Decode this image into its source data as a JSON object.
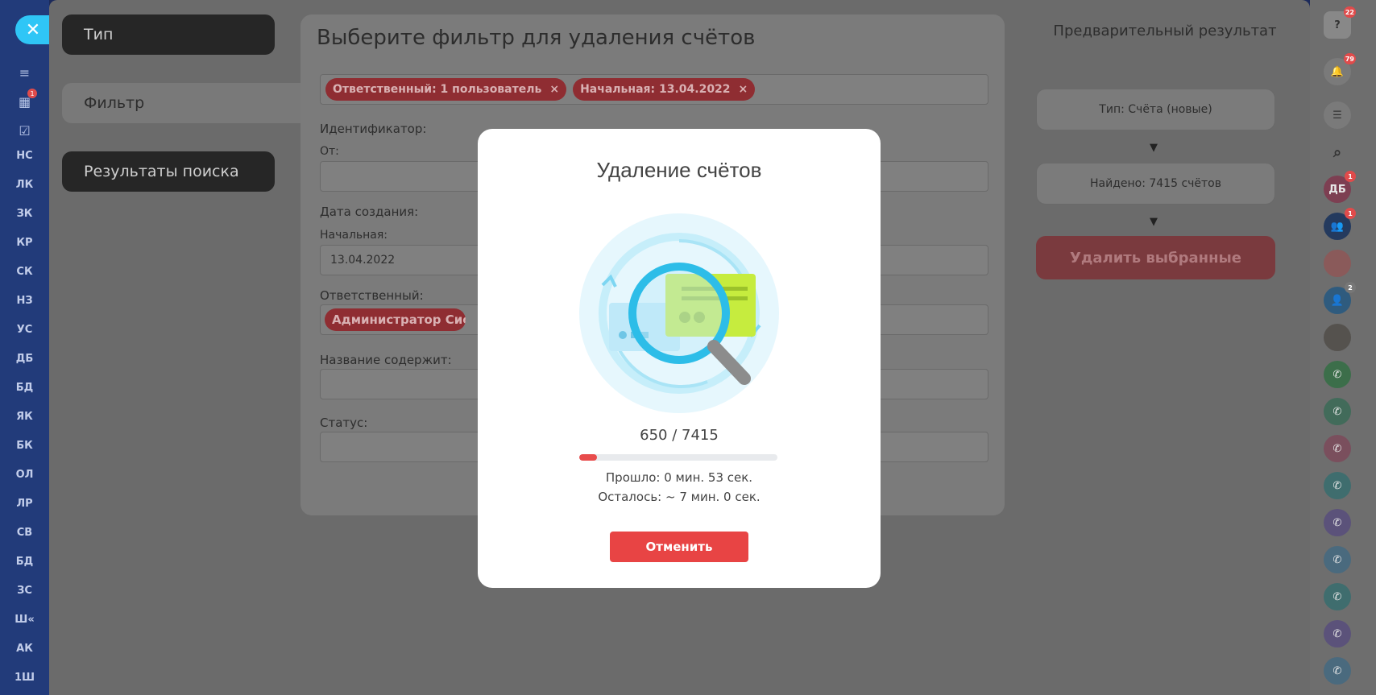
{
  "leftbar": {
    "close_icon": "close-icon",
    "icons": [
      {
        "name": "filter-icon",
        "glyph": "≡"
      },
      {
        "name": "calendar-icon",
        "glyph": "▦",
        "badge": "1"
      },
      {
        "name": "task-icon",
        "glyph": "☑"
      }
    ],
    "items": [
      "НС",
      "ЛК",
      "ЗК",
      "КР",
      "СК",
      "НЗ",
      "УС",
      "ДБ",
      "БД",
      "ЯК",
      "БК",
      "ОЛ",
      "ЛР",
      "СВ",
      "БД",
      "ЗС",
      "Ш«",
      "АК",
      "1Ш"
    ]
  },
  "nav": {
    "type_label": "Тип",
    "filter_label": "Фильтр",
    "results_label": "Результаты поиска"
  },
  "filter": {
    "title": "Выберите фильтр для удаления счётов",
    "chips": [
      "Ответственный: 1 пользователь",
      "Начальная: 13.04.2022"
    ],
    "id_label": "Идентификатор:",
    "from_label": "От:",
    "date_label": "Дата создания:",
    "start_label": "Начальная:",
    "start_value": "13.04.2022",
    "responsible_label": "Ответственный:",
    "responsible_chip": "Администратор Системы",
    "name_label": "Название содержит:",
    "status_label": "Статус:"
  },
  "result": {
    "title": "Предварительный результат",
    "type_box": "Тип: Счёта (новые)",
    "found_box": "Найдено: 7415 счётов",
    "delete_label": "Удалить выбранные"
  },
  "rightbar": {
    "help_badge": "22",
    "bell_badge": "79",
    "db_label": "ДБ",
    "db_badge": "1",
    "group_badge": "1",
    "users_badge": "2"
  },
  "modal": {
    "title": "Удаление счётов",
    "done": 650,
    "total": 7415,
    "count_text": "650 / 7415",
    "progress_fraction": 0.0877,
    "elapsed": "Прошло: 0 мин. 53 сек.",
    "remaining": "Осталось: ~ 7 мин. 0 сек.",
    "cancel_label": "Отменить"
  },
  "colors": {
    "accent_blue": "#2fc6f6",
    "danger": "#e84444",
    "sidebar": "#223b7a"
  }
}
